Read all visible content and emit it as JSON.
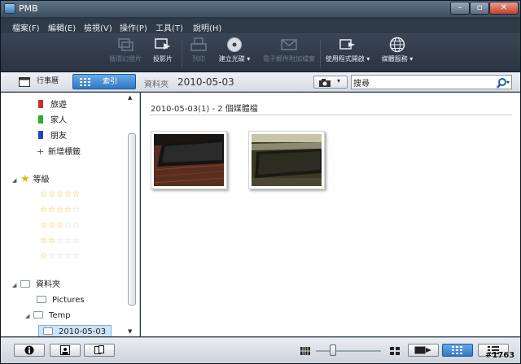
{
  "app": {
    "title": "PMB"
  },
  "menu": [
    {
      "label": "檔案(F)"
    },
    {
      "label": "編輯(E)"
    },
    {
      "label": "檢視(V)"
    },
    {
      "label": "操作(P)"
    },
    {
      "label": "工具(T)"
    },
    {
      "label": "說明(H)"
    }
  ],
  "toolbar": {
    "shuffle_label": "循環幻燈片",
    "slideshow_label": "投影片",
    "print_label": "列印",
    "disc_label": "建立光碟",
    "email_label": "電子郵件附加檔案",
    "open_with_label": "使用程式開啟",
    "upload_label": "媒體服務"
  },
  "viewbar": {
    "calendar_tab": "行事曆",
    "index_tab": "索引",
    "folder_label": "資料夾",
    "current_folder": "2010-05-03",
    "search_value": "搜尋"
  },
  "sidebar": {
    "tags": [
      {
        "label": "旅遊",
        "color": "#d12a2a"
      },
      {
        "label": "家人",
        "color": "#2faa2f"
      },
      {
        "label": "朋友",
        "color": "#2540c8"
      }
    ],
    "add_tag_label": "新增標籤",
    "rating_header": "等級",
    "ratings": [
      5,
      4,
      3,
      2,
      1
    ],
    "folders_header": "資料夾",
    "folders": [
      {
        "label": "Pictures"
      },
      {
        "label": "Temp"
      },
      {
        "label": "2010-05-03"
      }
    ]
  },
  "content": {
    "header": "2010-05-03(1)   - 2 個媒體檔",
    "thumbnails": [
      {
        "kind": "keyboard-on-wood"
      },
      {
        "kind": "keyboard-on-desk"
      }
    ]
  },
  "watermark": "#1763",
  "colors": {
    "accent": "#2f77c4",
    "toolbar_bg": "#2f3a48"
  }
}
